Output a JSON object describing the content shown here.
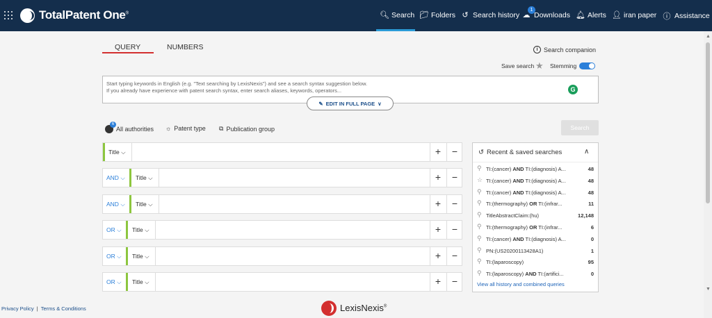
{
  "app": {
    "brand": "TotalPatent One",
    "brand_mark": "®"
  },
  "nav": {
    "search": "Search",
    "folders": "Folders",
    "history": "Search history",
    "downloads": "Downloads",
    "downloads_badge": "1",
    "alerts": "Alerts",
    "user": "iran paper",
    "assistance": "Assistance"
  },
  "tabs": {
    "query": "QUERY",
    "numbers": "NUMBERS"
  },
  "companion": "Search companion",
  "save_search": "Save search",
  "stemming": "Stemming",
  "stemming_on": true,
  "query": {
    "hint_line1": "Start typing keywords in English (e.g. \"Text searching by LexisNexis\") and see a search syntax suggestion below.",
    "hint_line2": "If you already have experience with patent search syntax, enter search aliases, keywords, operators...",
    "edit_full": "EDIT IN FULL PAGE"
  },
  "filters": {
    "authorities": "All authorities",
    "authorities_badge": "6",
    "patent_type": "Patent type",
    "publication_group": "Publication group",
    "search_button": "Search"
  },
  "rows": [
    {
      "op": "",
      "field": "Title"
    },
    {
      "op": "AND",
      "field": "Title"
    },
    {
      "op": "AND",
      "field": "Title"
    },
    {
      "op": "OR",
      "field": "Title"
    },
    {
      "op": "OR",
      "field": "Title"
    },
    {
      "op": "OR",
      "field": "Title"
    }
  ],
  "recent": {
    "title": "Recent & saved searches",
    "items": [
      {
        "icon": "search-icon",
        "a": "TI:(cancer) ",
        "op": "AND",
        "b": " TI:(diagnosis) A...",
        "count": "48"
      },
      {
        "icon": "star-icon",
        "a": "TI:(cancer) ",
        "op": "AND",
        "b": " TI:(diagnosis) A...",
        "count": "48"
      },
      {
        "icon": "search-icon",
        "a": "TI:(cancer) ",
        "op": "AND",
        "b": " TI:(diagnosis) A...",
        "count": "48"
      },
      {
        "icon": "search-icon",
        "a": "TI:(thermography) ",
        "op": "OR",
        "b": " TI:(infrar...",
        "count": "11"
      },
      {
        "icon": "search-icon",
        "a": "TitleAbstractClaim:(hu)",
        "op": "",
        "b": "",
        "count": "12,148"
      },
      {
        "icon": "search-icon",
        "a": "TI:(thermography) ",
        "op": "OR",
        "b": " TI:(infrar...",
        "count": "6"
      },
      {
        "icon": "search-icon",
        "a": "TI:(cancer) ",
        "op": "AND",
        "b": " TI:(diagnosis) A...",
        "count": "0"
      },
      {
        "icon": "search-icon",
        "a": "PN:(US20200113428A1)",
        "op": "",
        "b": "",
        "count": "1"
      },
      {
        "icon": "search-icon",
        "a": "TI:(laparoscopy)",
        "op": "",
        "b": "",
        "count": "95"
      },
      {
        "icon": "search-icon",
        "a": "TI:(laparoscopy) ",
        "op": "AND",
        "b": " TI:(artifici...",
        "count": "0"
      }
    ],
    "view_all": "View all history and combined queries"
  },
  "footer": {
    "privacy": "Privacy Policy",
    "separator": "|",
    "terms": "Terms & Conditions",
    "lexis": "LexisNexis",
    "lexis_mark": "®"
  },
  "colors": {
    "nav_bg": "#142e4c",
    "accent_blue": "#2b7fd9",
    "active_tab_red": "#d32f2f",
    "row_green": "#8dc63f"
  }
}
